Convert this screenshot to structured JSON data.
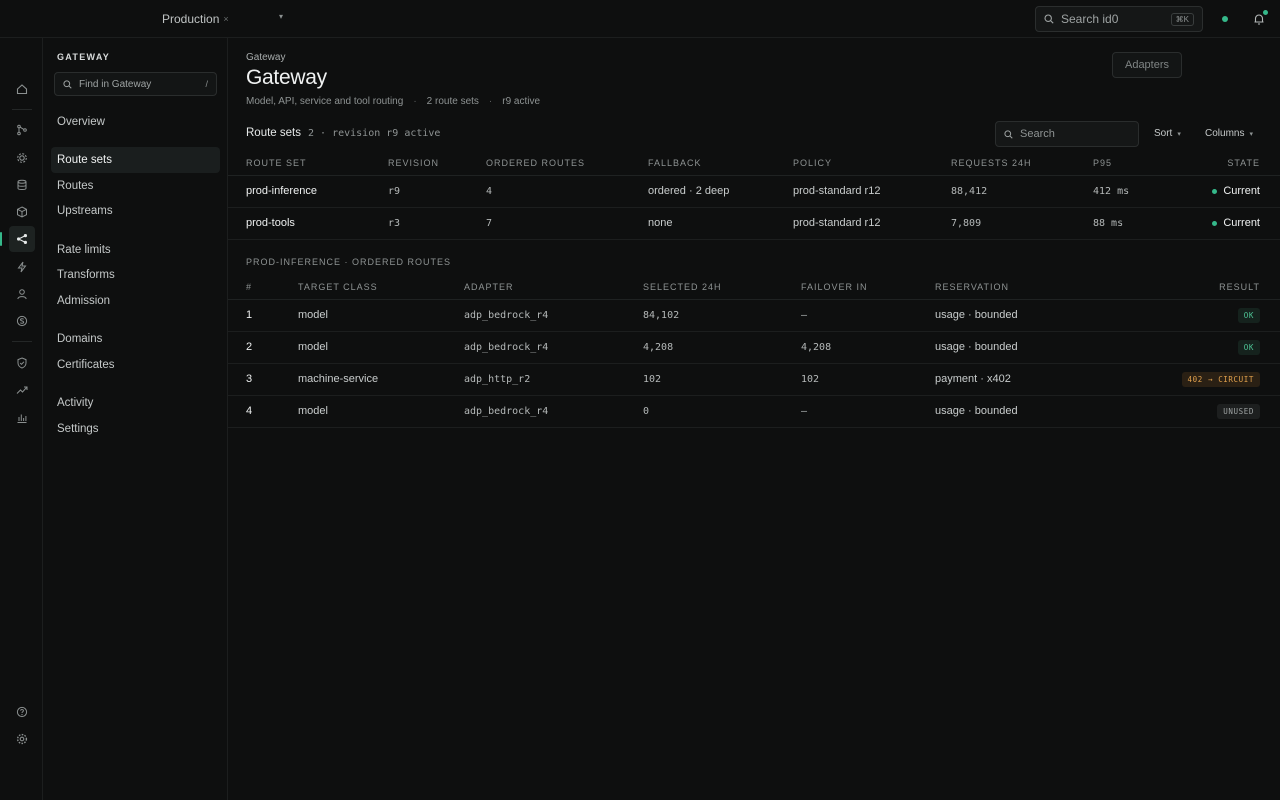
{
  "topbar": {
    "environment": "Production",
    "search_placeholder": "Search id0",
    "search_shortcut": "⌘K"
  },
  "rail": {
    "icons": [
      "home-icon",
      "branch-icon",
      "settings-cog-icon",
      "database-icon",
      "package-icon",
      "share-icon",
      "bolt-icon",
      "user-icon",
      "coin-icon",
      "shield-icon",
      "trend-icon",
      "bar-chart-icon",
      "help-icon",
      "gear-icon"
    ]
  },
  "sidebar": {
    "title": "GATEWAY",
    "find_placeholder": "Find in Gateway",
    "find_shortcut": "/",
    "items": [
      {
        "label": "Overview"
      },
      {
        "label": "Route sets"
      },
      {
        "label": "Routes"
      },
      {
        "label": "Upstreams"
      },
      {
        "label": "Rate limits"
      },
      {
        "label": "Transforms"
      },
      {
        "label": "Admission"
      },
      {
        "label": "Domains"
      },
      {
        "label": "Certificates"
      },
      {
        "label": "Activity"
      },
      {
        "label": "Settings"
      }
    ]
  },
  "page": {
    "breadcrumb": "Gateway",
    "title": "Gateway",
    "subtitle": "Model, API, service and tool routing",
    "route_sets_count": "2 route sets",
    "active_revision": "r9 active",
    "adapters_button": "Adapters"
  },
  "route_sets": {
    "title": "Route sets",
    "meta": "2 · revision r9 active",
    "search_placeholder": "Search",
    "sort_label": "Sort",
    "columns_label": "Columns",
    "headers": [
      "ROUTE SET",
      "REVISION",
      "ORDERED ROUTES",
      "FALLBACK",
      "POLICY",
      "REQUESTS 24H",
      "P95",
      "STATE"
    ],
    "rows": [
      {
        "name": "prod-inference",
        "revision": "r9",
        "ordered_routes": "4",
        "fallback": "ordered · 2 deep",
        "policy": "prod-standard r12",
        "requests": "88,412",
        "p95": "412 ms",
        "state": "Current"
      },
      {
        "name": "prod-tools",
        "revision": "r3",
        "ordered_routes": "7",
        "fallback": "none",
        "policy": "prod-standard r12",
        "requests": "7,809",
        "p95": "88 ms",
        "state": "Current"
      }
    ]
  },
  "ordered_routes": {
    "label": "PROD-INFERENCE · ORDERED ROUTES",
    "headers": [
      "#",
      "TARGET CLASS",
      "ADAPTER",
      "SELECTED 24H",
      "FAILOVER IN",
      "RESERVATION",
      "RESULT"
    ],
    "rows": [
      {
        "index": "1",
        "target_class": "model",
        "adapter": "adp_bedrock_r4",
        "selected": "84,102",
        "failover": "—",
        "reservation": "usage · bounded",
        "result": "OK"
      },
      {
        "index": "2",
        "target_class": "model",
        "adapter": "adp_bedrock_r4",
        "selected": "4,208",
        "failover": "4,208",
        "reservation": "usage · bounded",
        "result": "OK"
      },
      {
        "index": "3",
        "target_class": "machine-service",
        "adapter": "adp_http_r2",
        "selected": "102",
        "failover": "102",
        "reservation": "payment · x402",
        "result": "402 → CIRCUIT"
      },
      {
        "index": "4",
        "target_class": "model",
        "adapter": "adp_bedrock_r4",
        "selected": "0",
        "failover": "—",
        "reservation": "usage · bounded",
        "result": "UNUSED"
      }
    ]
  },
  "colors": {
    "accent": "#35b88a",
    "warning": "#e0a04c",
    "background": "#0e0f0f"
  }
}
